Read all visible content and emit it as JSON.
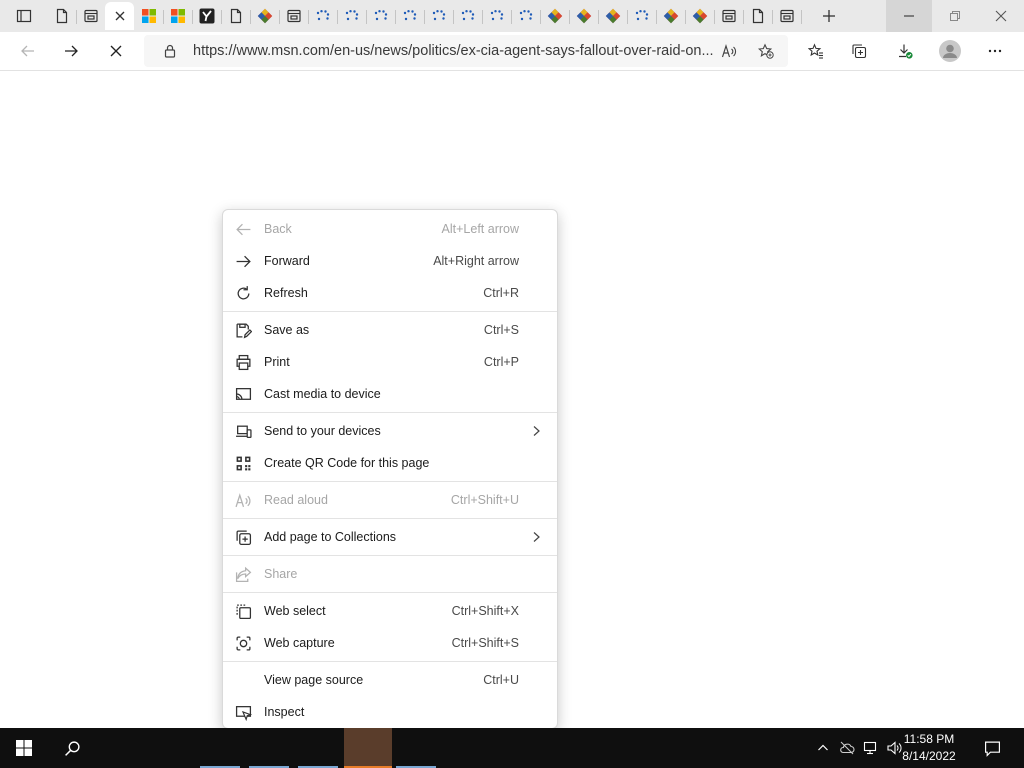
{
  "browser": {
    "tabs": [
      {
        "icon": "page-icon"
      },
      {
        "icon": "window-icon"
      },
      {
        "icon": "close-icon",
        "active": true
      },
      {
        "icon": "microsoft-logo-icon"
      },
      {
        "icon": "microsoft-logo-icon"
      },
      {
        "icon": "yahoo-logo-icon"
      },
      {
        "icon": "page-icon"
      },
      {
        "icon": "colorful-diamond-icon"
      },
      {
        "icon": "window-icon"
      },
      {
        "icon": "dots-loading-icon"
      },
      {
        "icon": "dots-loading-icon"
      },
      {
        "icon": "dots-loading-icon"
      },
      {
        "icon": "dots-loading-icon"
      },
      {
        "icon": "dots-loading-icon"
      },
      {
        "icon": "dots-loading-icon"
      },
      {
        "icon": "dots-loading-icon"
      },
      {
        "icon": "dots-loading-icon"
      },
      {
        "icon": "colorful-diamond-icon"
      },
      {
        "icon": "colorful-diamond-icon"
      },
      {
        "icon": "colorful-diamond-icon"
      },
      {
        "icon": "dots-loading-icon"
      },
      {
        "icon": "colorful-diamond-icon"
      },
      {
        "icon": "colorful-diamond-icon"
      },
      {
        "icon": "window-icon"
      },
      {
        "icon": "page-icon"
      },
      {
        "icon": "window-icon"
      }
    ],
    "address": {
      "url": "https://www.msn.com/en-us/news/politics/ex-cia-agent-says-fallout-over-raid-on..."
    }
  },
  "context_menu": {
    "items": [
      {
        "label": "Back",
        "shortcut": "Alt+Left arrow",
        "icon": "arrow-left-icon",
        "disabled": true
      },
      {
        "label": "Forward",
        "shortcut": "Alt+Right arrow",
        "icon": "arrow-right-icon"
      },
      {
        "label": "Refresh",
        "shortcut": "Ctrl+R",
        "icon": "refresh-icon"
      },
      {
        "label": "Save as",
        "shortcut": "Ctrl+S",
        "icon": "save-as-icon"
      },
      {
        "label": "Print",
        "shortcut": "Ctrl+P",
        "icon": "print-icon"
      },
      {
        "label": "Cast media to device",
        "shortcut": "",
        "icon": "cast-icon"
      },
      {
        "label": "Send to your devices",
        "shortcut": "",
        "icon": "send-devices-icon",
        "submenu": true
      },
      {
        "label": "Create QR Code for this page",
        "shortcut": "",
        "icon": "qr-code-icon"
      },
      {
        "label": "Read aloud",
        "shortcut": "Ctrl+Shift+U",
        "icon": "read-aloud-icon",
        "disabled": true
      },
      {
        "label": "Add page to Collections",
        "shortcut": "",
        "icon": "collections-icon",
        "submenu": true
      },
      {
        "label": "Share",
        "shortcut": "",
        "icon": "share-icon",
        "disabled": true
      },
      {
        "label": "Web select",
        "shortcut": "Ctrl+Shift+X",
        "icon": "web-select-icon"
      },
      {
        "label": "Web capture",
        "shortcut": "Ctrl+Shift+S",
        "icon": "web-capture-icon"
      },
      {
        "label": "View page source",
        "shortcut": "Ctrl+U",
        "icon": ""
      },
      {
        "label": "Inspect",
        "shortcut": "",
        "icon": "inspect-icon"
      }
    ]
  },
  "taskbar": {
    "time": "11:58 PM",
    "date": "8/14/2022"
  },
  "colors": {
    "tabstrip": "#e9e9e9",
    "taskbar": "#0f0f0f",
    "accent": "#0078d4",
    "active_app": "#5a3d2b",
    "app_indicator": "#7aa7d3",
    "active_indicator": "#e87c28"
  }
}
